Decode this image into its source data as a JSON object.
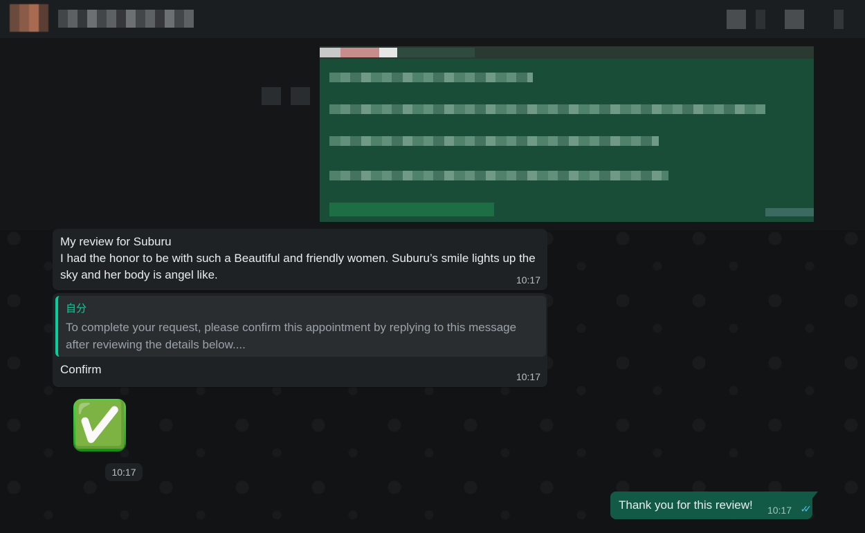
{
  "header": {
    "contact_name": "",
    "avatar": "blurred-contact-avatar",
    "icons": [
      "video-call-icon",
      "divider",
      "search-icon",
      "menu-icon"
    ]
  },
  "messages": [
    {
      "type": "image",
      "direction": "outgoing",
      "content": "pixelated-image"
    },
    {
      "type": "text",
      "direction": "incoming",
      "text": "My review for Suburu\nI had the honor to be with such a Beautiful and friendly women. Suburu’s smile lights up the sky and her body is angel like.",
      "time": "10:17"
    },
    {
      "type": "reply",
      "direction": "incoming",
      "quote_author": "自分",
      "quote_text": "To complete your request, please confirm this appointment by replying to this message after reviewing the details below....",
      "text": "Confirm",
      "time": "10:17"
    },
    {
      "type": "sticker",
      "direction": "incoming",
      "emoji": "✅",
      "time": "10:17"
    },
    {
      "type": "text",
      "direction": "outgoing",
      "text": "Thank you for this review!",
      "time": "10:17",
      "status": "read-double-check"
    }
  ],
  "colors": {
    "incoming_bubble": "#1f2224",
    "outgoing_bubble": "#125a46",
    "quote_accent": "#06cf9c",
    "read_ticks": "#53bdeb"
  }
}
